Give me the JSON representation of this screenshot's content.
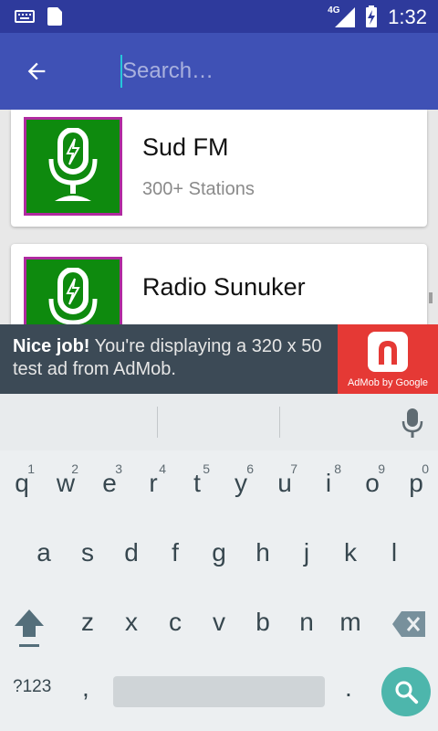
{
  "status_bar": {
    "network": "4G",
    "time": "1:32",
    "icons": [
      "keyboard-icon",
      "sd-card-icon",
      "signal-icon",
      "battery-charging-icon"
    ]
  },
  "app_bar": {
    "back_icon": "arrow-back-icon",
    "search_placeholder": "Search…",
    "search_value": ""
  },
  "stations": [
    {
      "title": "Sud FM",
      "subtitle": "300+ Stations",
      "icon": "microphone-icon"
    },
    {
      "title": "Radio Sunuker",
      "subtitle": "",
      "icon": "microphone-icon"
    }
  ],
  "ad": {
    "lead": "Nice job!",
    "text": " You're displaying a 320 x 50 test ad from AdMob.",
    "brand": "AdMob by Google"
  },
  "keyboard": {
    "row1": [
      {
        "key": "q",
        "hint": "1"
      },
      {
        "key": "w",
        "hint": "2"
      },
      {
        "key": "e",
        "hint": "3"
      },
      {
        "key": "r",
        "hint": "4"
      },
      {
        "key": "t",
        "hint": "5"
      },
      {
        "key": "y",
        "hint": "6"
      },
      {
        "key": "u",
        "hint": "7"
      },
      {
        "key": "i",
        "hint": "8"
      },
      {
        "key": "o",
        "hint": "9"
      },
      {
        "key": "p",
        "hint": "0"
      }
    ],
    "row2": [
      "a",
      "s",
      "d",
      "f",
      "g",
      "h",
      "j",
      "k",
      "l"
    ],
    "row3": [
      "z",
      "x",
      "c",
      "v",
      "b",
      "n",
      "m"
    ],
    "symbols_label": "?123",
    "comma": ",",
    "period": ".",
    "colors": {
      "search_key": "#4db6ac",
      "app_bar": "#3f51b5",
      "status_bar": "#2e3a9c"
    }
  }
}
